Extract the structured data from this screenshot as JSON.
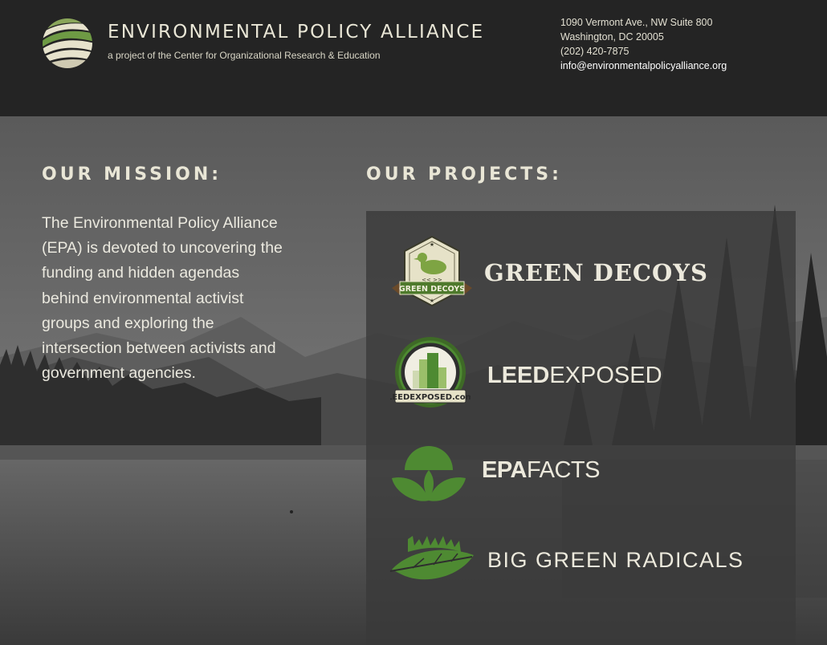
{
  "header": {
    "org_name": "ENVIRONMENTAL POLICY ALLIANCE",
    "org_subtitle": "a project of the Center for Organizational Research & Education",
    "logo_icon": "swirl-globe-icon",
    "contact": {
      "address_line1": "1090 Vermont Ave., NW Suite 800",
      "address_line2": "Washington, DC 20005",
      "phone": "(202) 420-7875",
      "email": "info@environmentalpolicyalliance.org"
    }
  },
  "mission": {
    "heading": "OUR MISSION:",
    "text": "The Environmental Policy Alliance (EPA) is devoted to uncovering the funding and hidden agendas behind environmental activist groups and exploring the intersection between activists and government agencies."
  },
  "projects": {
    "heading": "OUR PROJECTS:",
    "items": [
      {
        "title": "GREEN DECOYS",
        "badge_text": "GREEN DECOYS",
        "icon": "duck-decoy-icon"
      },
      {
        "title_bold": "LEED",
        "title_light": "EXPOSED",
        "badge_text": "LEEDEXPOSED.com",
        "icon": "buildings-seal-icon"
      },
      {
        "title_bold": "EPA",
        "title_light": "FACTS",
        "icon": "leaf-sprout-icon"
      },
      {
        "title": "BIG GREEN RADICALS",
        "icon": "protest-leaf-icon"
      }
    ]
  },
  "colors": {
    "header_bg": "#242424",
    "text_cream": "#e9e6d6",
    "brand_green": "#4e8a32",
    "panel_bg": "#3a3a3a"
  }
}
